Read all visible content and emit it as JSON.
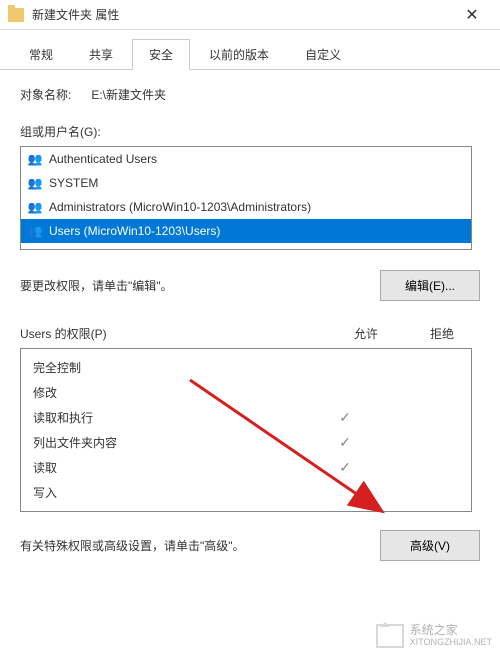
{
  "titlebar": {
    "title": "新建文件夹 属性"
  },
  "tabs": [
    {
      "label": "常规",
      "active": false
    },
    {
      "label": "共享",
      "active": false
    },
    {
      "label": "安全",
      "active": true
    },
    {
      "label": "以前的版本",
      "active": false
    },
    {
      "label": "自定义",
      "active": false
    }
  ],
  "object": {
    "label": "对象名称:",
    "value": "E:\\新建文件夹"
  },
  "groups": {
    "label": "组或用户名(G):",
    "items": [
      {
        "name": "Authenticated Users",
        "selected": false
      },
      {
        "name": "SYSTEM",
        "selected": false
      },
      {
        "name": "Administrators (MicroWin10-1203\\Administrators)",
        "selected": false
      },
      {
        "name": "Users (MicroWin10-1203\\Users)",
        "selected": true
      }
    ]
  },
  "edit": {
    "hint": "要更改权限，请单击\"编辑\"。",
    "button": "编辑(E)..."
  },
  "permissions": {
    "title": "Users 的权限(P)",
    "allow_label": "允许",
    "deny_label": "拒绝",
    "rows": [
      {
        "name": "完全控制",
        "allow": false,
        "deny": false
      },
      {
        "name": "修改",
        "allow": false,
        "deny": false
      },
      {
        "name": "读取和执行",
        "allow": true,
        "deny": false
      },
      {
        "name": "列出文件夹内容",
        "allow": true,
        "deny": false
      },
      {
        "name": "读取",
        "allow": true,
        "deny": false
      },
      {
        "name": "写入",
        "allow": false,
        "deny": false
      }
    ]
  },
  "advanced": {
    "hint": "有关特殊权限或高级设置，请单击\"高级\"。",
    "button": "高级(V)"
  },
  "watermark": "系统之家",
  "arrow_color": "#d62020"
}
